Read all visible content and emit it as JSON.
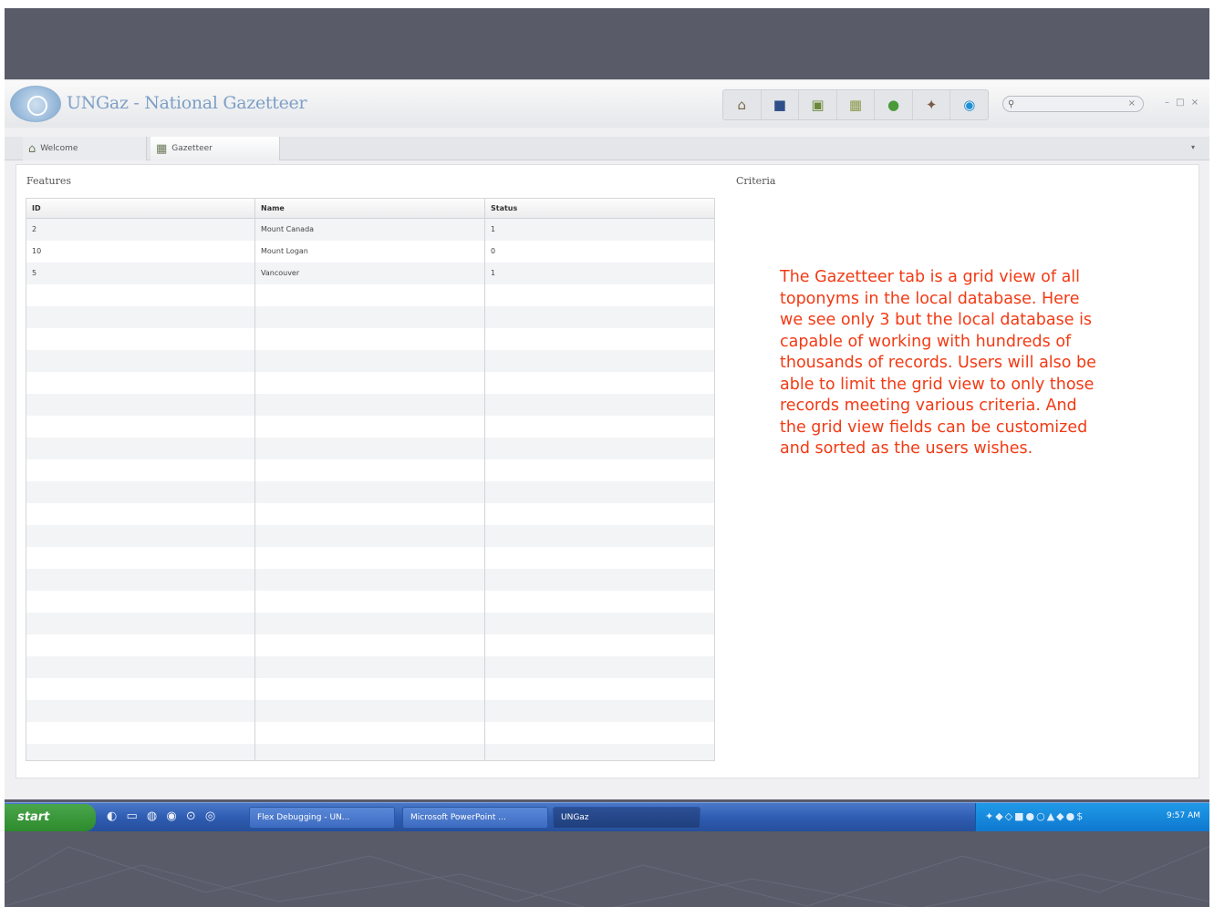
{
  "app": {
    "title": "UNGaz - National Gazetteer",
    "toolbar_icons": [
      "home-icon",
      "folder-icon",
      "document-icon",
      "map-icon",
      "globe-icon",
      "settings-icon",
      "help-icon"
    ],
    "toolbar_glyphs": [
      "⌂",
      "■",
      "▣",
      "▦",
      "●",
      "✦",
      "◉"
    ],
    "search": {
      "placeholder": "",
      "mag": "⚲",
      "clear": "×"
    },
    "window_controls": "– □ ×"
  },
  "tabs": [
    {
      "label": "Welcome",
      "icon": "house-icon",
      "glyph": "⌂"
    },
    {
      "label": "Gazetteer",
      "icon": "grid-icon",
      "glyph": "▦"
    }
  ],
  "tabs_more": "▾",
  "features": {
    "label": "Features",
    "columns": [
      "ID",
      "Name",
      "Status"
    ],
    "rows": [
      [
        "2",
        "Mount Canada",
        "1"
      ],
      [
        "10",
        "Mount Logan",
        "0"
      ],
      [
        "5",
        "Vancouver",
        "1"
      ]
    ]
  },
  "criteria": {
    "label": "Criteria"
  },
  "note": "The Gazetteer tab is a grid view of all toponyms in the local database. Here we see only 3 but the local database is capable of working with hundreds of thousands of records. Users will also be able to limit the grid view to only those records meeting various criteria. And the grid view fields can be customized and sorted as the users wishes.",
  "taskbar": {
    "start": "start",
    "quicklaunch": "◐ ▭ ◍ ◉ ⊙ ◎",
    "tasks": [
      {
        "label": "Flex Debugging - UN...",
        "active": false
      },
      {
        "label": "Microsoft PowerPoint ...",
        "active": false
      },
      {
        "label": "UNGaz",
        "active": true
      }
    ],
    "tray_icons": "✦◆◇■●○▲◆●$",
    "clock": "9:57 AM"
  }
}
